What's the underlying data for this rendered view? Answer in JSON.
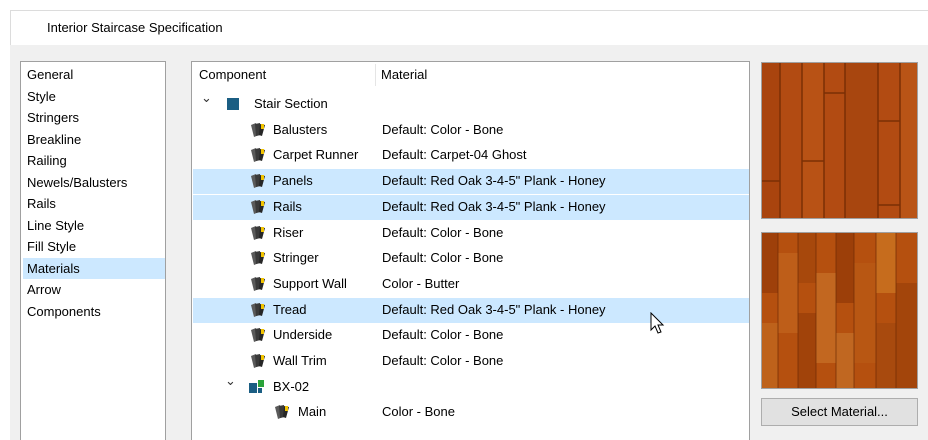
{
  "window": {
    "title": "Interior Staircase Specification"
  },
  "nav": {
    "items": [
      {
        "label": "General",
        "selected": false
      },
      {
        "label": "Style",
        "selected": false
      },
      {
        "label": "Stringers",
        "selected": false
      },
      {
        "label": "Breakline",
        "selected": false
      },
      {
        "label": "Railing",
        "selected": false
      },
      {
        "label": "Newels/Balusters",
        "selected": false
      },
      {
        "label": "Rails",
        "selected": false
      },
      {
        "label": "Line Style",
        "selected": false
      },
      {
        "label": "Fill Style",
        "selected": false
      },
      {
        "label": "Materials",
        "selected": true
      },
      {
        "label": "Arrow",
        "selected": false
      },
      {
        "label": "Components",
        "selected": false
      }
    ]
  },
  "tree": {
    "headers": {
      "component": "Component",
      "material": "Material"
    },
    "rows": [
      {
        "kind": "group",
        "name": "Stair Section",
        "material": "",
        "icon": "blue-square-icon",
        "expanded": true,
        "selected": false
      },
      {
        "kind": "item",
        "name": "Balusters",
        "material": "Default: Color - Bone",
        "icon": "paint-swatch-icon",
        "selected": false
      },
      {
        "kind": "item",
        "name": "Carpet Runner",
        "material": "Default: Carpet-04 Ghost",
        "icon": "paint-swatch-icon",
        "selected": false
      },
      {
        "kind": "item",
        "name": "Panels",
        "material": "Default: Red Oak 3-4-5\" Plank - Honey",
        "icon": "paint-swatch-icon",
        "selected": true
      },
      {
        "kind": "item",
        "name": "Rails",
        "material": "Default: Red Oak 3-4-5\" Plank - Honey",
        "icon": "paint-swatch-icon",
        "selected": true
      },
      {
        "kind": "item",
        "name": "Riser",
        "material": "Default: Color - Bone",
        "icon": "paint-swatch-icon",
        "selected": false
      },
      {
        "kind": "item",
        "name": "Stringer",
        "material": "Default: Color - Bone",
        "icon": "paint-swatch-icon",
        "selected": false
      },
      {
        "kind": "item",
        "name": "Support Wall",
        "material": "Color - Butter",
        "icon": "paint-swatch-icon",
        "selected": false
      },
      {
        "kind": "item",
        "name": "Tread",
        "material": "Default: Red Oak 3-4-5\" Plank - Honey",
        "icon": "paint-swatch-icon",
        "selected": true
      },
      {
        "kind": "item",
        "name": "Underside",
        "material": "Default: Color - Bone",
        "icon": "paint-swatch-icon",
        "selected": false
      },
      {
        "kind": "item",
        "name": "Wall Trim",
        "material": "Default: Color - Bone",
        "icon": "paint-swatch-icon",
        "selected": false
      },
      {
        "kind": "subgroup",
        "name": "BX-02",
        "material": "",
        "icon": "component-cube-icon",
        "expanded": true,
        "selected": false
      },
      {
        "kind": "subitem",
        "name": "Main",
        "material": "Color - Bone",
        "icon": "paint-swatch-icon",
        "selected": false
      }
    ]
  },
  "preview": {
    "select_button_label": "Select Material..."
  },
  "colors": {
    "selection": "#cce8ff",
    "wood_base": "#b24a0f",
    "wood_dark": "#7a2f05",
    "group_icon": "#1b5e83"
  }
}
